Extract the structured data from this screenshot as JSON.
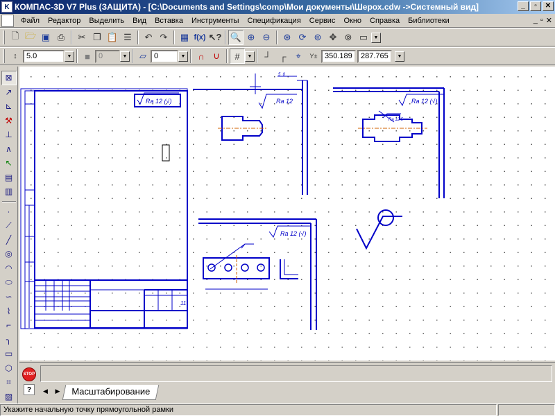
{
  "window": {
    "title": "КОМПАС-3D V7 Plus (ЗАЩИТА) - [C:\\Documents and Settings\\comp\\Мои документы\\Шерох.cdw ->Системный вид]",
    "app_icon_glyph": "K",
    "minimize_glyph": "_",
    "maximize_glyph": "▫",
    "close_glyph": "✕"
  },
  "menu": {
    "items": [
      "Файл",
      "Редактор",
      "Выделить",
      "Вид",
      "Вставка",
      "Инструменты",
      "Спецификация",
      "Сервис",
      "Окно",
      "Справка",
      "Библиотеки"
    ],
    "mdi_buttons": [
      "_",
      "▫",
      "✕"
    ]
  },
  "toolbar2": {
    "line_style": "5.0",
    "color_value": "0",
    "layer_value": "0",
    "coord_x": "350.189",
    "coord_y": "287.765"
  },
  "drawing": {
    "roughness_labels": [
      "Ra 12 (√)",
      "Ra 12",
      "Ra 12 (√)",
      "Ra 12 (√)",
      "Ra 12.5"
    ],
    "dimension_labels": [
      "5_0",
      "5_0"
    ],
    "stamp_sheet_number": "11"
  },
  "properties": {
    "stop_label": "STOP",
    "help_label": "?",
    "nav_left": "◀",
    "nav_right": "▶",
    "tab_label": "Масштабирование"
  },
  "status": {
    "prompt": "Укажите начальную точку прямоугольной рамки"
  },
  "colors": {
    "titlebar": "#0a246a",
    "drawing_line": "#0000c8",
    "axis_line": "#d06000"
  }
}
